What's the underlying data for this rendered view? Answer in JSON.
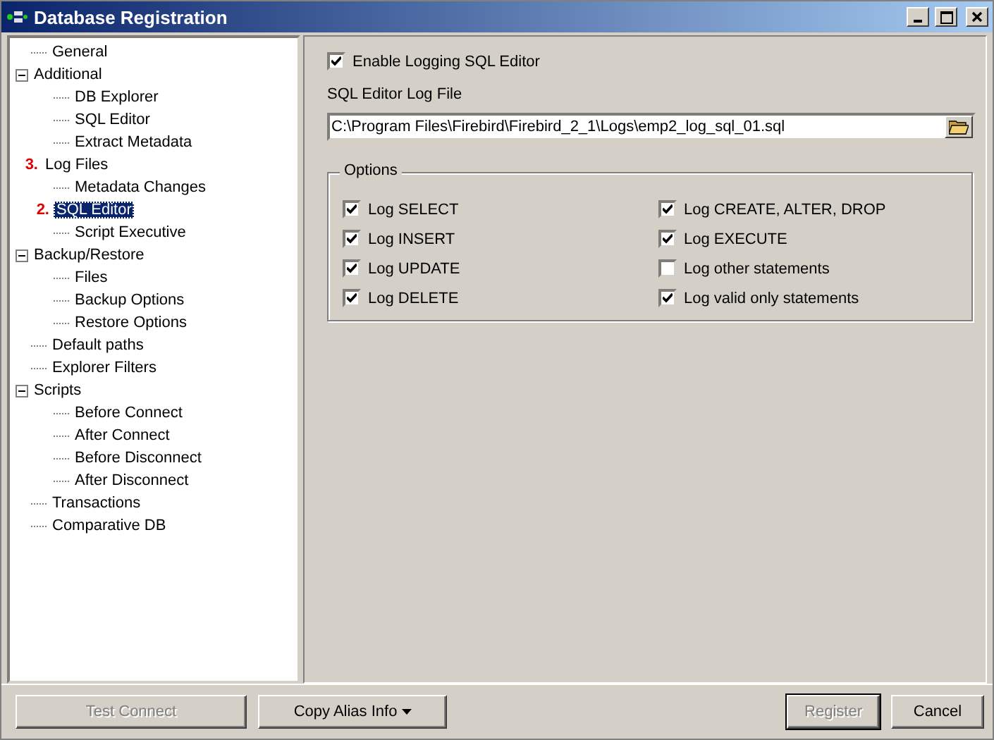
{
  "window": {
    "title": "Database Registration"
  },
  "tree": [
    {
      "label": "General",
      "selected": false
    },
    {
      "label": "Additional",
      "selected": false,
      "expanded": true,
      "children": [
        {
          "label": "DB Explorer",
          "selected": false
        },
        {
          "label": "SQL Editor",
          "selected": false
        },
        {
          "label": "Extract Metadata",
          "selected": false
        }
      ]
    },
    {
      "label": "Log Files",
      "selected": false,
      "annotation": "3.",
      "expanded": true,
      "children": [
        {
          "label": "Metadata Changes",
          "selected": false
        },
        {
          "label": "SQL Editor",
          "selected": true,
          "annotation": "2."
        },
        {
          "label": "Script Executive",
          "selected": false
        }
      ]
    },
    {
      "label": "Backup/Restore",
      "selected": false,
      "expanded": true,
      "children": [
        {
          "label": "Files",
          "selected": false
        },
        {
          "label": "Backup Options",
          "selected": false
        },
        {
          "label": "Restore Options",
          "selected": false
        }
      ]
    },
    {
      "label": "Default paths",
      "selected": false
    },
    {
      "label": "Explorer Filters",
      "selected": false
    },
    {
      "label": "Scripts",
      "selected": false,
      "expanded": true,
      "children": [
        {
          "label": "Before Connect",
          "selected": false
        },
        {
          "label": "After Connect",
          "selected": false
        },
        {
          "label": "Before Disconnect",
          "selected": false
        },
        {
          "label": "After Disconnect",
          "selected": false
        }
      ]
    },
    {
      "label": "Transactions",
      "selected": false
    },
    {
      "label": "Comparative DB",
      "selected": false
    }
  ],
  "enable_logging": {
    "label": "Enable Logging SQL Editor",
    "checked": true
  },
  "log_file": {
    "label": "SQL Editor Log File",
    "value": "C:\\Program Files\\Firebird\\Firebird_2_1\\Logs\\emp2_log_sql_01.sql"
  },
  "options": {
    "title": "Options",
    "items": [
      {
        "label": "Log SELECT",
        "checked": true
      },
      {
        "label": "Log CREATE, ALTER, DROP",
        "checked": true
      },
      {
        "label": "Log INSERT",
        "checked": true
      },
      {
        "label": "Log EXECUTE",
        "checked": true
      },
      {
        "label": "Log UPDATE",
        "checked": true
      },
      {
        "label": "Log other statements",
        "checked": false
      },
      {
        "label": "Log DELETE",
        "checked": true
      },
      {
        "label": "Log valid only statements",
        "checked": true
      }
    ]
  },
  "buttons": [
    {
      "label": "Test Connect",
      "disabled": true,
      "kind": "plain"
    },
    {
      "label": "Copy Alias Info",
      "disabled": false,
      "kind": "dropdown"
    },
    {
      "label": "Register",
      "disabled": true,
      "kind": "default"
    },
    {
      "label": "Cancel",
      "disabled": false,
      "kind": "plain"
    }
  ]
}
